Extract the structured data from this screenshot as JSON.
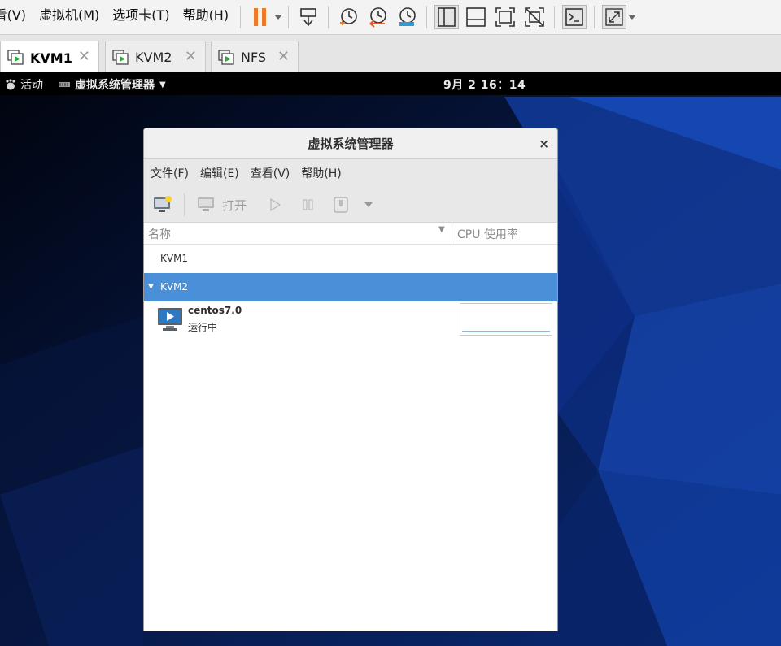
{
  "vmware": {
    "menu": [
      "查看(V)",
      "虚拟机(M)",
      "选项卡(T)",
      "帮助(H)"
    ],
    "tabs": [
      {
        "label": "KVM1",
        "active": true
      },
      {
        "label": "KVM2",
        "active": false
      },
      {
        "label": "NFS",
        "active": false
      }
    ],
    "close_glyph": "✕"
  },
  "gnome": {
    "activities": "活动",
    "app_menu": "虚拟系统管理器",
    "clock": "9月 2 16：14"
  },
  "vmm": {
    "title": "虚拟系统管理器",
    "close": "×",
    "menu": [
      "文件(F)",
      "编辑(E)",
      "查看(V)",
      "帮助(H)"
    ],
    "toolbar": {
      "open_label": "打开"
    },
    "columns": {
      "name": "名称",
      "cpu": "CPU 使用率"
    },
    "connections": [
      {
        "name": "KVM1",
        "selected": false
      },
      {
        "name": "KVM2",
        "selected": true
      }
    ],
    "vm": {
      "name": "centos7.0",
      "status": "运行中"
    }
  },
  "colors": {
    "selection": "#4a90d9",
    "pause": "#ee7a27",
    "revert": "#e8582e",
    "snapshot_mgr": "#2e9bd6",
    "tab_icon_green": "#2ea73d"
  }
}
